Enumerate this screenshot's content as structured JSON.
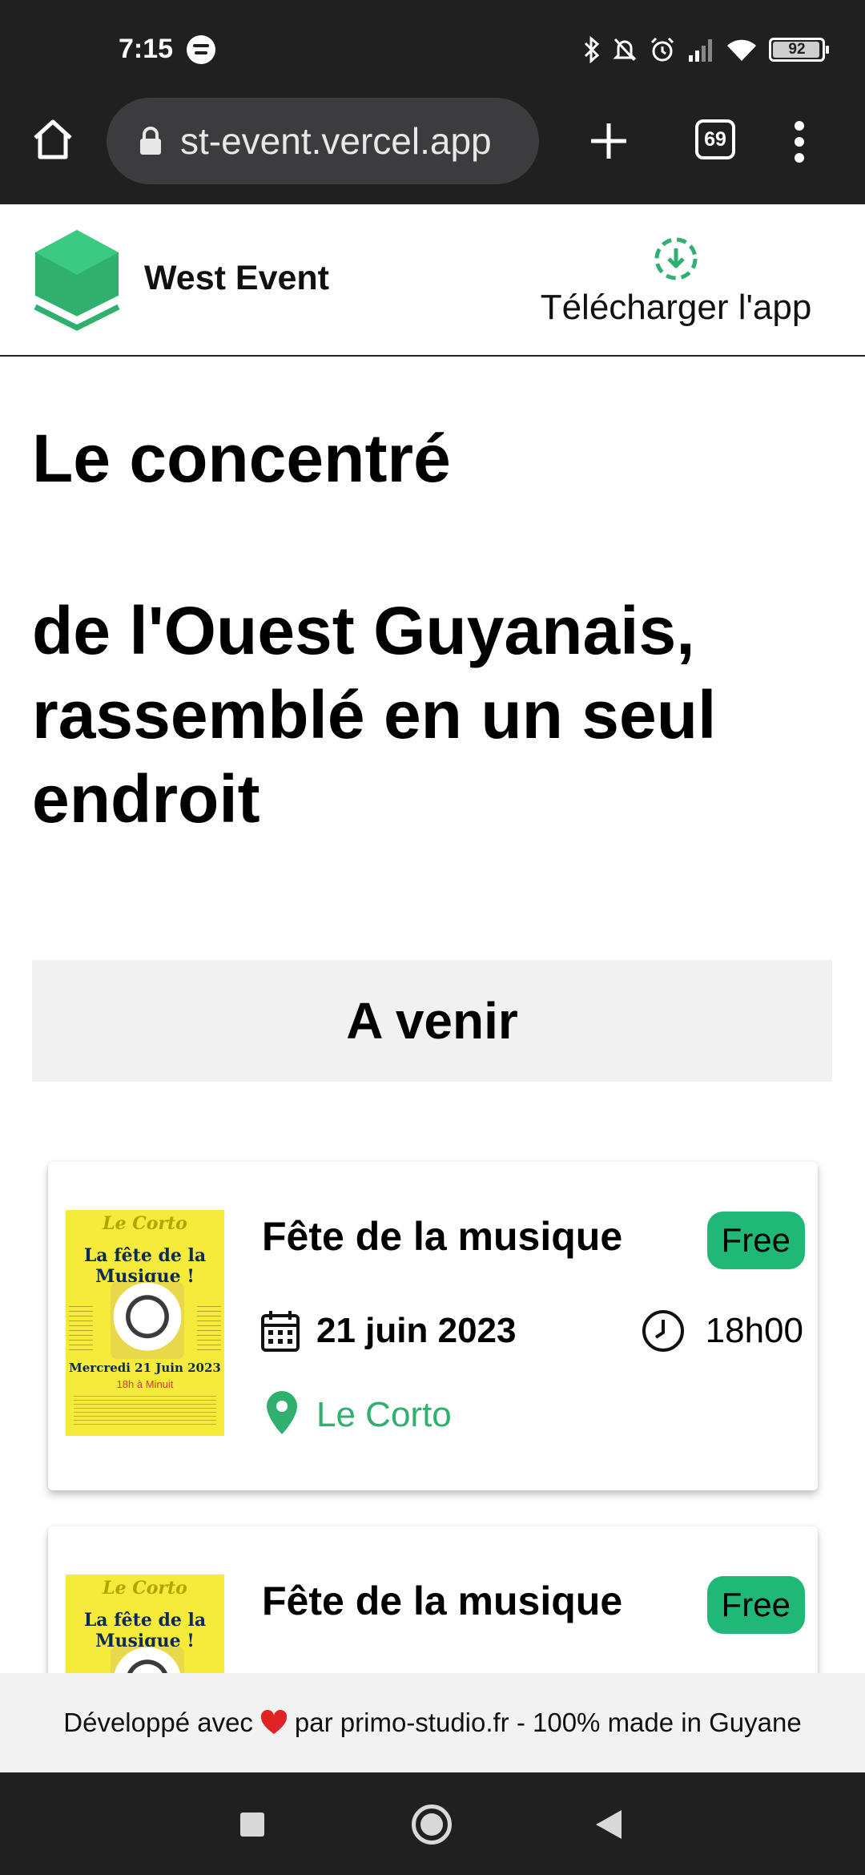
{
  "status_bar": {
    "time": "7:15",
    "battery_percent": "92",
    "icons": [
      "spotify-icon",
      "bluetooth-icon",
      "bell-off-icon",
      "alarm-icon",
      "signal-icon",
      "wifi-icon",
      "battery-icon"
    ]
  },
  "browser": {
    "url_text": "st-event.vercel.app",
    "tab_count": "69",
    "icons": [
      "home-icon",
      "lock-icon",
      "plus-icon",
      "more-icon"
    ]
  },
  "header": {
    "brand": "West Event",
    "download_label": "Télécharger l'app",
    "brand_color": "#2fb06e"
  },
  "hero": {
    "line1": "Le concentré",
    "line2": "de l'Ouest Guyanais, rassemblé en un seul endroit"
  },
  "section": {
    "title": "A venir"
  },
  "events": [
    {
      "title": "Fête de la musique",
      "price": "Free",
      "date": "21 juin 2023",
      "time": "18h00",
      "location": "Le Corto",
      "poster": {
        "top": "Le Corto",
        "title": "La fête de la Musique !",
        "date": "Mercredi 21 Juin 2023",
        "sub": "18h à Minuit"
      }
    },
    {
      "title": "Fête de la musique",
      "price": "Free",
      "date": "",
      "time": "",
      "location": "",
      "poster": {
        "top": "Le Corto",
        "title": "La fête de la Musique !"
      }
    }
  ],
  "footer": {
    "before": "Développé avec",
    "after": "par primo-studio.fr - 100% made in Guyane"
  },
  "colors": {
    "badge": "#20b877",
    "accent": "#2fb06e",
    "dark_bar": "#202020"
  }
}
